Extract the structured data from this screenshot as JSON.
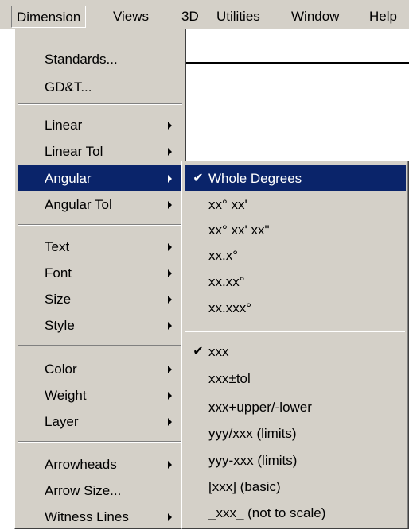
{
  "menubar": {
    "items": [
      "Dimension",
      "Views",
      "3D",
      "Utilities",
      "Window",
      "Help"
    ]
  },
  "dimension_menu": {
    "items": [
      {
        "label": "Standards..."
      },
      {
        "label": "GD&T..."
      },
      {
        "label": "Linear",
        "submenu": true
      },
      {
        "label": "Linear Tol",
        "submenu": true
      },
      {
        "label": "Angular",
        "submenu": true,
        "highlighted": true
      },
      {
        "label": "Angular Tol",
        "submenu": true
      },
      {
        "label": "Text",
        "submenu": true
      },
      {
        "label": "Font",
        "submenu": true
      },
      {
        "label": "Size",
        "submenu": true
      },
      {
        "label": "Style",
        "submenu": true
      },
      {
        "label": "Color",
        "submenu": true
      },
      {
        "label": "Weight",
        "submenu": true
      },
      {
        "label": "Layer",
        "submenu": true
      },
      {
        "label": "Arrowheads",
        "submenu": true
      },
      {
        "label": "Arrow Size..."
      },
      {
        "label": "Witness Lines",
        "submenu": true
      }
    ]
  },
  "angular_submenu": {
    "items": [
      {
        "label": "Whole Degrees",
        "checked": true,
        "highlighted": true
      },
      {
        "label": "xx° xx'"
      },
      {
        "label": "xx° xx' xx\""
      },
      {
        "label": "xx.x°"
      },
      {
        "label": "xx.xx°"
      },
      {
        "label": "xx.xxx°"
      },
      {
        "label": "xxx",
        "checked": true
      },
      {
        "label": "xxx±tol"
      },
      {
        "label": "xxx+upper/-lower"
      },
      {
        "label": "yyy/xxx (limits)"
      },
      {
        "label": "yyy-xxx (limits)"
      },
      {
        "label": "[xxx] (basic)"
      },
      {
        "label": "_xxx_ (not to scale)"
      }
    ]
  },
  "check_glyph": "✔",
  "colors": {
    "menu_bg": "#d4d0c8",
    "highlight": "#0a246a",
    "highlight_text": "#ffffff"
  }
}
